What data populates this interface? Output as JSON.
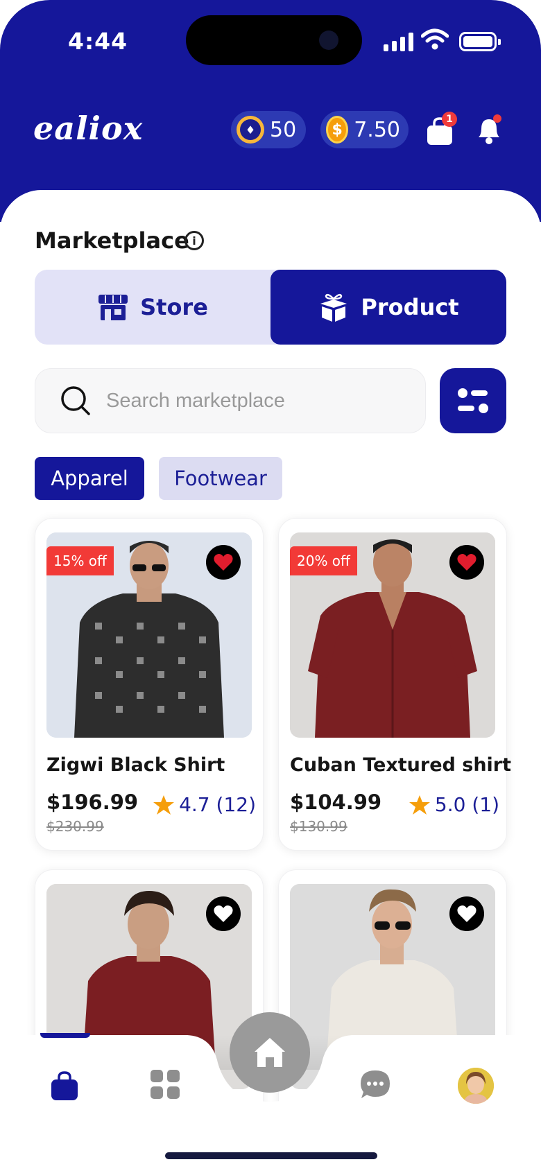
{
  "status_bar": {
    "time": "4:44"
  },
  "header": {
    "logo": "ealiox",
    "gems": "50",
    "coins": "7.50",
    "cart_badge": "1",
    "icons": [
      "gem-icon",
      "coin-icon",
      "shopping-bag-icon",
      "bell-icon"
    ]
  },
  "marketplace": {
    "title": "Marketplace",
    "segments": [
      {
        "label": "Store",
        "icon": "store-icon",
        "active": false
      },
      {
        "label": "Product",
        "icon": "gift-box-icon",
        "active": true
      }
    ],
    "search_placeholder": "Search marketplace",
    "chips": [
      {
        "label": "Apparel",
        "active": true
      },
      {
        "label": "Footwear",
        "active": false
      }
    ]
  },
  "products": [
    {
      "discount": "15% off",
      "name": "Zigwi Black Shirt",
      "price": "$196.99",
      "old_price": "$230.99",
      "rating": "4.7 (12)",
      "favorite": true
    },
    {
      "discount": "20% off",
      "name": "Cuban Textured shirt",
      "price": "$104.99",
      "old_price": "$130.99",
      "rating": "5.0 (1)",
      "favorite": true
    },
    {
      "discount": "",
      "name": "",
      "price": "",
      "old_price": "",
      "rating": "",
      "favorite": false
    },
    {
      "discount": "",
      "name": "",
      "price": "",
      "old_price": "",
      "rating": "",
      "favorite": false
    }
  ],
  "bottom_nav": {
    "items": [
      "shopping-bag-icon",
      "grid-icon",
      "home-icon",
      "chat-icon",
      "avatar"
    ],
    "active": "shopping-bag-icon"
  },
  "colors": {
    "brand": "#15179a",
    "brand_light": "#e2e2f7",
    "discount": "#f23a37",
    "star": "#f59e0b",
    "heart": "#e11d2e"
  }
}
